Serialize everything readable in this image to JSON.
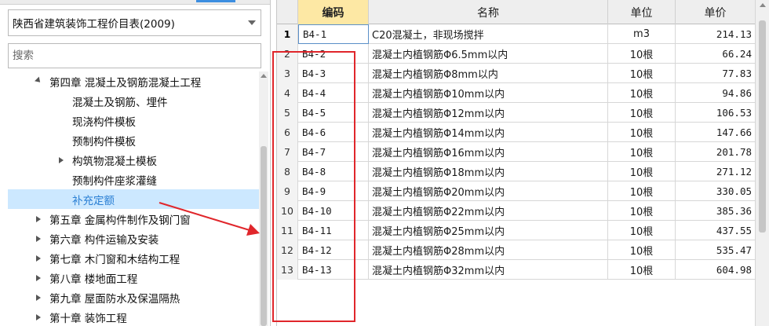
{
  "left_panel": {
    "library_select": {
      "value": "陕西省建筑装饰工程价目表(2009)"
    },
    "search": {
      "placeholder": "搜索"
    },
    "tree": [
      {
        "label": "第四章 混凝土及钢筋混凝土工程",
        "level": 1,
        "toggle": "open"
      },
      {
        "label": "混凝土及钢筋、埋件",
        "level": 2,
        "toggle": "none"
      },
      {
        "label": "现浇构件模板",
        "level": 2,
        "toggle": "none"
      },
      {
        "label": "预制构件模板",
        "level": 2,
        "toggle": "none"
      },
      {
        "label": "构筑物混凝土模板",
        "level": 2,
        "toggle": "closed"
      },
      {
        "label": "预制构件座浆灌缝",
        "level": 2,
        "toggle": "none"
      },
      {
        "label": "补充定额",
        "level": 2,
        "toggle": "none",
        "selected": true
      },
      {
        "label": "第五章 金属构件制作及钢门窗",
        "level": 1,
        "toggle": "closed"
      },
      {
        "label": "第六章 构件运输及安装",
        "level": 1,
        "toggle": "closed"
      },
      {
        "label": "第七章 木门窗和木结构工程",
        "level": 1,
        "toggle": "closed"
      },
      {
        "label": "第八章 楼地面工程",
        "level": 1,
        "toggle": "closed"
      },
      {
        "label": "第九章 屋面防水及保温隔热",
        "level": 1,
        "toggle": "closed"
      },
      {
        "label": "第十章 装饰工程",
        "level": 1,
        "toggle": "closed"
      }
    ]
  },
  "grid": {
    "headers": {
      "code": "编码",
      "name": "名称",
      "unit": "单位",
      "price": "单价"
    },
    "rows": [
      {
        "num": "1",
        "code": "B4-1",
        "name": "C20混凝土，非现场搅拌",
        "unit": "m3",
        "price": "214.13"
      },
      {
        "num": "2",
        "code": "B4-2",
        "name": "混凝土内植钢筋Φ6.5mm以内",
        "unit": "10根",
        "price": "66.24"
      },
      {
        "num": "3",
        "code": "B4-3",
        "name": "混凝土内植钢筋Φ8mm以内",
        "unit": "10根",
        "price": "77.83"
      },
      {
        "num": "4",
        "code": "B4-4",
        "name": "混凝土内植钢筋Φ10mm以内",
        "unit": "10根",
        "price": "94.86"
      },
      {
        "num": "5",
        "code": "B4-5",
        "name": "混凝土内植钢筋Φ12mm以内",
        "unit": "10根",
        "price": "106.53"
      },
      {
        "num": "6",
        "code": "B4-6",
        "name": "混凝土内植钢筋Φ14mm以内",
        "unit": "10根",
        "price": "147.66"
      },
      {
        "num": "7",
        "code": "B4-7",
        "name": "混凝土内植钢筋Φ16mm以内",
        "unit": "10根",
        "price": "201.78"
      },
      {
        "num": "8",
        "code": "B4-8",
        "name": "混凝土内植钢筋Φ18mm以内",
        "unit": "10根",
        "price": "271.12"
      },
      {
        "num": "9",
        "code": "B4-9",
        "name": "混凝土内植钢筋Φ20mm以内",
        "unit": "10根",
        "price": "330.05"
      },
      {
        "num": "10",
        "code": "B4-10",
        "name": "混凝土内植钢筋Φ22mm以内",
        "unit": "10根",
        "price": "385.36"
      },
      {
        "num": "11",
        "code": "B4-11",
        "name": "混凝土内植钢筋Φ25mm以内",
        "unit": "10根",
        "price": "437.55"
      },
      {
        "num": "12",
        "code": "B4-12",
        "name": "混凝土内植钢筋Φ28mm以内",
        "unit": "10根",
        "price": "535.47"
      },
      {
        "num": "13",
        "code": "B4-13",
        "name": "混凝土内植钢筋Φ32mm以内",
        "unit": "10根",
        "price": "604.98"
      }
    ]
  },
  "colors": {
    "annotation": "#e0262b",
    "selection": "#cce8ff",
    "selection_text": "#2a7fd4",
    "active_header": "#fde8a4"
  },
  "icons": {
    "dropdown": "chevron-down-icon",
    "expanded": "expanded-triangle-icon",
    "collapsed": "collapsed-triangle-icon",
    "annotation_arrow": "arrow-icon"
  }
}
